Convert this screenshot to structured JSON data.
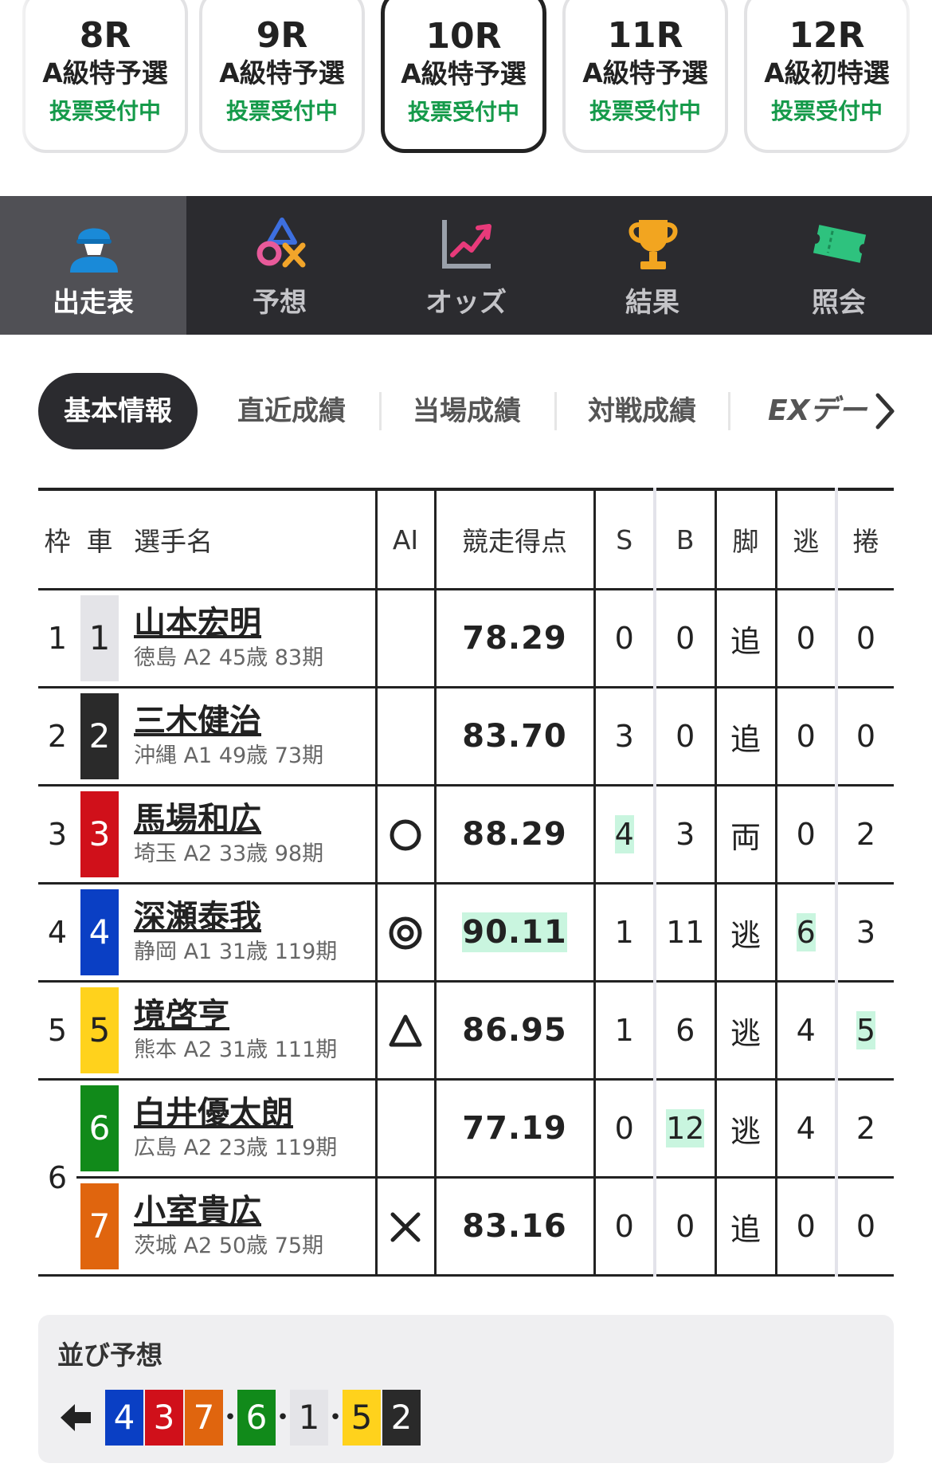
{
  "race_tabs": [
    {
      "num": "8R",
      "name": "A級特予選",
      "status": "投票受付中"
    },
    {
      "num": "9R",
      "name": "A級特予選",
      "status": "投票受付中"
    },
    {
      "num": "10R",
      "name": "A級特予選",
      "status": "投票受付中",
      "active": true
    },
    {
      "num": "11R",
      "name": "A級特予選",
      "status": "投票受付中"
    },
    {
      "num": "12R",
      "name": "A級初特選",
      "status": "投票受付中"
    }
  ],
  "main_nav": [
    {
      "label": "出走表",
      "icon": "rider-icon",
      "active": true
    },
    {
      "label": "予想",
      "icon": "prediction-marks-icon"
    },
    {
      "label": "オッズ",
      "icon": "odds-chart-icon"
    },
    {
      "label": "結果",
      "icon": "trophy-icon"
    },
    {
      "label": "照会",
      "icon": "ticket-icon"
    }
  ],
  "sub_tabs": {
    "active": "基本情報",
    "items": [
      "直近成績",
      "当場成績",
      "対戦成績"
    ],
    "truncated": "EXデー"
  },
  "table": {
    "headers": {
      "waku": "枠",
      "car": "車",
      "name": "選手名",
      "ai": "AI",
      "score": "競走得点",
      "s": "S",
      "b": "B",
      "leg": "脚",
      "nige": "逃",
      "makuri": "捲"
    },
    "rows": [
      {
        "waku": "1",
        "car": "1",
        "name": "山本宏明",
        "info": "徳島 A2 45歳 83期",
        "ai": "",
        "score": "78.29",
        "s": "0",
        "b": "0",
        "leg": "追",
        "nige": "0",
        "makuri": "0"
      },
      {
        "waku": "2",
        "car": "2",
        "name": "三木健治",
        "info": "沖縄 A1 49歳 73期",
        "ai": "",
        "score": "83.70",
        "s": "3",
        "b": "0",
        "leg": "追",
        "nige": "0",
        "makuri": "0"
      },
      {
        "waku": "3",
        "car": "3",
        "name": "馬場和広",
        "info": "埼玉 A2 33歳 98期",
        "ai": "circle",
        "score": "88.29",
        "s": "4",
        "b": "3",
        "leg": "両",
        "nige": "0",
        "makuri": "2"
      },
      {
        "waku": "4",
        "car": "4",
        "name": "深瀬泰我",
        "info": "静岡 A1 31歳 119期",
        "ai": "double-circle",
        "score": "90.11",
        "s": "1",
        "b": "11",
        "leg": "逃",
        "nige": "6",
        "makuri": "3"
      },
      {
        "waku": "5",
        "car": "5",
        "name": "境啓亨",
        "info": "熊本 A2 31歳 111期",
        "ai": "triangle",
        "score": "86.95",
        "s": "1",
        "b": "6",
        "leg": "逃",
        "nige": "4",
        "makuri": "5"
      },
      {
        "waku": "6",
        "car": "6",
        "name": "白井優太朗",
        "info": "広島 A2 23歳 119期",
        "ai": "",
        "score": "77.19",
        "s": "0",
        "b": "12",
        "leg": "逃",
        "nige": "4",
        "makuri": "2"
      },
      {
        "waku": "",
        "car": "7",
        "name": "小室貴広",
        "info": "茨城 A2 50歳 75期",
        "ai": "cross",
        "score": "83.16",
        "s": "0",
        "b": "0",
        "leg": "追",
        "nige": "0",
        "makuri": "0"
      }
    ]
  },
  "car_colors": {
    "1": {
      "bg": "#e4e4e8",
      "fg": "#222222"
    },
    "2": {
      "bg": "#2a2a2a",
      "fg": "#ffffff"
    },
    "3": {
      "bg": "#d0101a",
      "fg": "#ffffff"
    },
    "4": {
      "bg": "#0a3fc4",
      "fg": "#ffffff"
    },
    "5": {
      "bg": "#ffd21c",
      "fg": "#222222"
    },
    "6": {
      "bg": "#118a1a",
      "fg": "#ffffff"
    },
    "7": {
      "bg": "#e0650e",
      "fg": "#ffffff"
    }
  },
  "highlight_color": "#c9f5df",
  "line_prediction": {
    "title": "並び予想",
    "groups": [
      [
        "4",
        "3",
        "7"
      ],
      [
        "6"
      ],
      [
        "1"
      ],
      [
        "5",
        "2"
      ]
    ]
  }
}
